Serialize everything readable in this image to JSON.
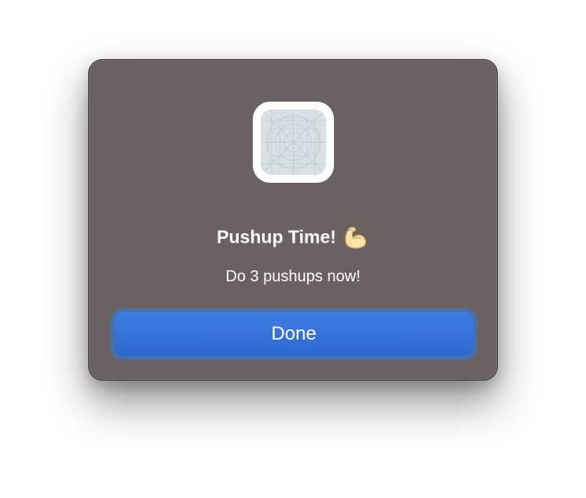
{
  "alert": {
    "title": "Pushup Time!",
    "title_emoji": "flexed-biceps",
    "message": "Do 3 pushups now!",
    "button_label": "Done",
    "app_icon": "generic-app-icon"
  },
  "colors": {
    "panel_background": "#6b6163",
    "button_accent": "#3478e0",
    "text": "#ffffff"
  }
}
